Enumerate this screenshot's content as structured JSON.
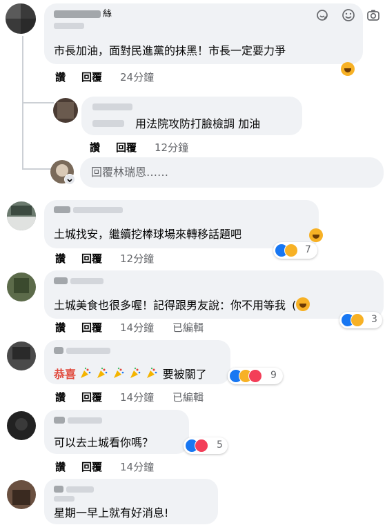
{
  "actions": {
    "like": "讚",
    "reply": "回覆"
  },
  "comments": [
    {
      "name_suffix": "絲",
      "text": "市長加油，面對民進黨的抹黑！市長一定要力爭",
      "time": "24分鐘"
    },
    {
      "text": "用法院攻防打臉檢調 加油",
      "time": "12分鐘"
    },
    {
      "text": "土城找安，繼續挖棒球場來轉移話題吧",
      "time": "12分鐘",
      "reaction_count": "7"
    },
    {
      "text": "土城美食也很多喔！記得跟男友說：你不用等我",
      "text_tail": "(",
      "time": "14分鐘",
      "edited": "已編輯",
      "reaction_count": "3"
    },
    {
      "highlight": "恭喜",
      "text": "要被關了",
      "time": "14分鐘",
      "edited": "已編輯",
      "reaction_count": "9"
    },
    {
      "text": "可以去土城看你嗎？",
      "time": "14分鐘",
      "reaction_count": "5"
    },
    {
      "text": "星期一早上就有好消息!"
    }
  ],
  "reply_box": {
    "placeholder": "回覆林瑞恩……",
    "icons": [
      "sticker-icon",
      "emoji-icon",
      "camera-icon",
      "gif-icon"
    ]
  },
  "colors": {
    "bubble": "#f0f2f5",
    "like": "#1877f2",
    "haha": "#f7b125",
    "love": "#f33e58",
    "meta": "#65676b",
    "highlight": "#e0473a"
  }
}
